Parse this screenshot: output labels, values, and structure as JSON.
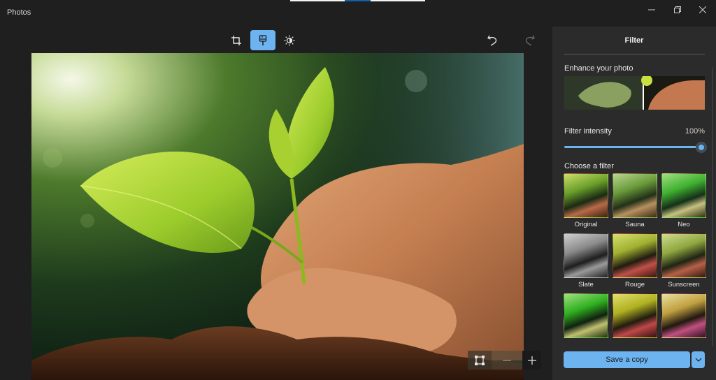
{
  "window": {
    "title": "Photos",
    "controls": {
      "minimize": "minimize-icon",
      "maximize": "restore-icon",
      "close": "close-icon"
    }
  },
  "toolbar": {
    "tools": [
      {
        "id": "crop",
        "icon": "crop-icon",
        "label": "Crop & rotate",
        "active": false
      },
      {
        "id": "filter",
        "icon": "filter-brush-icon",
        "label": "Filter",
        "active": true
      },
      {
        "id": "adjust",
        "icon": "brightness-icon",
        "label": "Adjustment",
        "active": false
      }
    ],
    "undo_icon": "undo-icon",
    "redo_icon": "redo-icon",
    "redo_enabled": false
  },
  "canvas": {
    "image_description": "Seedling held by a child's hand and an adult's hand above soil, sunlit green background"
  },
  "zoom_controls": {
    "fit_icon": "fit-to-screen-icon",
    "zoom_out_icon": "minus-icon",
    "zoom_in_icon": "plus-icon"
  },
  "panel": {
    "title": "Filter",
    "enhance_label": "Enhance your photo",
    "intensity_label": "Filter intensity",
    "intensity_value": "100%",
    "intensity_fraction": 1.0,
    "choose_label": "Choose a filter",
    "filters": [
      {
        "name": "Original",
        "selected": false
      },
      {
        "name": "Sauna",
        "selected": true
      },
      {
        "name": "Neo",
        "selected": false
      },
      {
        "name": "Slate",
        "selected": false
      },
      {
        "name": "Rouge",
        "selected": false
      },
      {
        "name": "Sunscreen",
        "selected": false
      },
      {
        "name": "",
        "selected": false
      },
      {
        "name": "",
        "selected": false
      },
      {
        "name": "",
        "selected": false
      }
    ],
    "save_label": "Save a copy",
    "save_dropdown_icon": "chevron-down-icon"
  },
  "colors": {
    "accent": "#6cb3f0",
    "background": "#1f1f1f",
    "panel": "#2b2b2b"
  }
}
